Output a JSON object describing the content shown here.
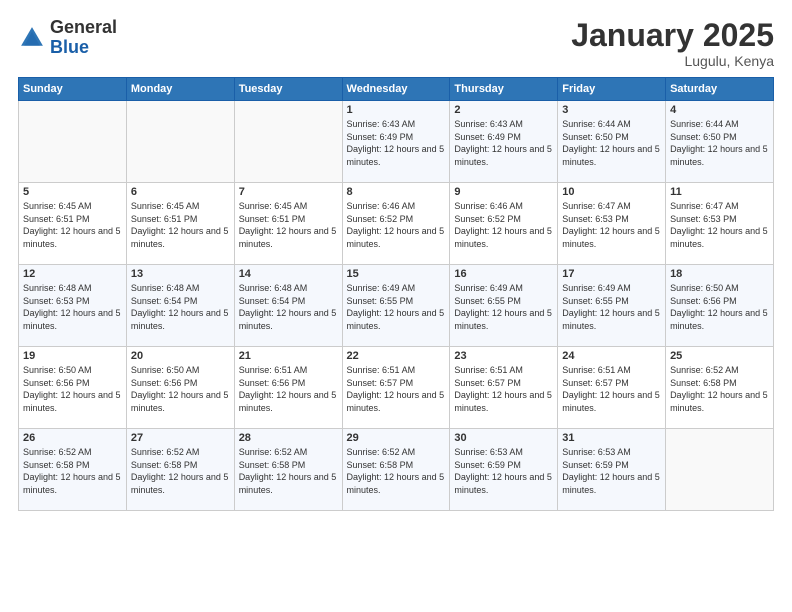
{
  "header": {
    "logo_general": "General",
    "logo_blue": "Blue",
    "title": "January 2025",
    "subtitle": "Lugulu, Kenya"
  },
  "columns": [
    "Sunday",
    "Monday",
    "Tuesday",
    "Wednesday",
    "Thursday",
    "Friday",
    "Saturday"
  ],
  "weeks": [
    [
      {
        "day": "",
        "info": ""
      },
      {
        "day": "",
        "info": ""
      },
      {
        "day": "",
        "info": ""
      },
      {
        "day": "1",
        "info": "Sunrise: 6:43 AM\nSunset: 6:49 PM\nDaylight: 12 hours and 5 minutes."
      },
      {
        "day": "2",
        "info": "Sunrise: 6:43 AM\nSunset: 6:49 PM\nDaylight: 12 hours and 5 minutes."
      },
      {
        "day": "3",
        "info": "Sunrise: 6:44 AM\nSunset: 6:50 PM\nDaylight: 12 hours and 5 minutes."
      },
      {
        "day": "4",
        "info": "Sunrise: 6:44 AM\nSunset: 6:50 PM\nDaylight: 12 hours and 5 minutes."
      }
    ],
    [
      {
        "day": "5",
        "info": "Sunrise: 6:45 AM\nSunset: 6:51 PM\nDaylight: 12 hours and 5 minutes."
      },
      {
        "day": "6",
        "info": "Sunrise: 6:45 AM\nSunset: 6:51 PM\nDaylight: 12 hours and 5 minutes."
      },
      {
        "day": "7",
        "info": "Sunrise: 6:45 AM\nSunset: 6:51 PM\nDaylight: 12 hours and 5 minutes."
      },
      {
        "day": "8",
        "info": "Sunrise: 6:46 AM\nSunset: 6:52 PM\nDaylight: 12 hours and 5 minutes."
      },
      {
        "day": "9",
        "info": "Sunrise: 6:46 AM\nSunset: 6:52 PM\nDaylight: 12 hours and 5 minutes."
      },
      {
        "day": "10",
        "info": "Sunrise: 6:47 AM\nSunset: 6:53 PM\nDaylight: 12 hours and 5 minutes."
      },
      {
        "day": "11",
        "info": "Sunrise: 6:47 AM\nSunset: 6:53 PM\nDaylight: 12 hours and 5 minutes."
      }
    ],
    [
      {
        "day": "12",
        "info": "Sunrise: 6:48 AM\nSunset: 6:53 PM\nDaylight: 12 hours and 5 minutes."
      },
      {
        "day": "13",
        "info": "Sunrise: 6:48 AM\nSunset: 6:54 PM\nDaylight: 12 hours and 5 minutes."
      },
      {
        "day": "14",
        "info": "Sunrise: 6:48 AM\nSunset: 6:54 PM\nDaylight: 12 hours and 5 minutes."
      },
      {
        "day": "15",
        "info": "Sunrise: 6:49 AM\nSunset: 6:55 PM\nDaylight: 12 hours and 5 minutes."
      },
      {
        "day": "16",
        "info": "Sunrise: 6:49 AM\nSunset: 6:55 PM\nDaylight: 12 hours and 5 minutes."
      },
      {
        "day": "17",
        "info": "Sunrise: 6:49 AM\nSunset: 6:55 PM\nDaylight: 12 hours and 5 minutes."
      },
      {
        "day": "18",
        "info": "Sunrise: 6:50 AM\nSunset: 6:56 PM\nDaylight: 12 hours and 5 minutes."
      }
    ],
    [
      {
        "day": "19",
        "info": "Sunrise: 6:50 AM\nSunset: 6:56 PM\nDaylight: 12 hours and 5 minutes."
      },
      {
        "day": "20",
        "info": "Sunrise: 6:50 AM\nSunset: 6:56 PM\nDaylight: 12 hours and 5 minutes."
      },
      {
        "day": "21",
        "info": "Sunrise: 6:51 AM\nSunset: 6:56 PM\nDaylight: 12 hours and 5 minutes."
      },
      {
        "day": "22",
        "info": "Sunrise: 6:51 AM\nSunset: 6:57 PM\nDaylight: 12 hours and 5 minutes."
      },
      {
        "day": "23",
        "info": "Sunrise: 6:51 AM\nSunset: 6:57 PM\nDaylight: 12 hours and 5 minutes."
      },
      {
        "day": "24",
        "info": "Sunrise: 6:51 AM\nSunset: 6:57 PM\nDaylight: 12 hours and 5 minutes."
      },
      {
        "day": "25",
        "info": "Sunrise: 6:52 AM\nSunset: 6:58 PM\nDaylight: 12 hours and 5 minutes."
      }
    ],
    [
      {
        "day": "26",
        "info": "Sunrise: 6:52 AM\nSunset: 6:58 PM\nDaylight: 12 hours and 5 minutes."
      },
      {
        "day": "27",
        "info": "Sunrise: 6:52 AM\nSunset: 6:58 PM\nDaylight: 12 hours and 5 minutes."
      },
      {
        "day": "28",
        "info": "Sunrise: 6:52 AM\nSunset: 6:58 PM\nDaylight: 12 hours and 5 minutes."
      },
      {
        "day": "29",
        "info": "Sunrise: 6:52 AM\nSunset: 6:58 PM\nDaylight: 12 hours and 5 minutes."
      },
      {
        "day": "30",
        "info": "Sunrise: 6:53 AM\nSunset: 6:59 PM\nDaylight: 12 hours and 5 minutes."
      },
      {
        "day": "31",
        "info": "Sunrise: 6:53 AM\nSunset: 6:59 PM\nDaylight: 12 hours and 5 minutes."
      },
      {
        "day": "",
        "info": ""
      }
    ]
  ]
}
